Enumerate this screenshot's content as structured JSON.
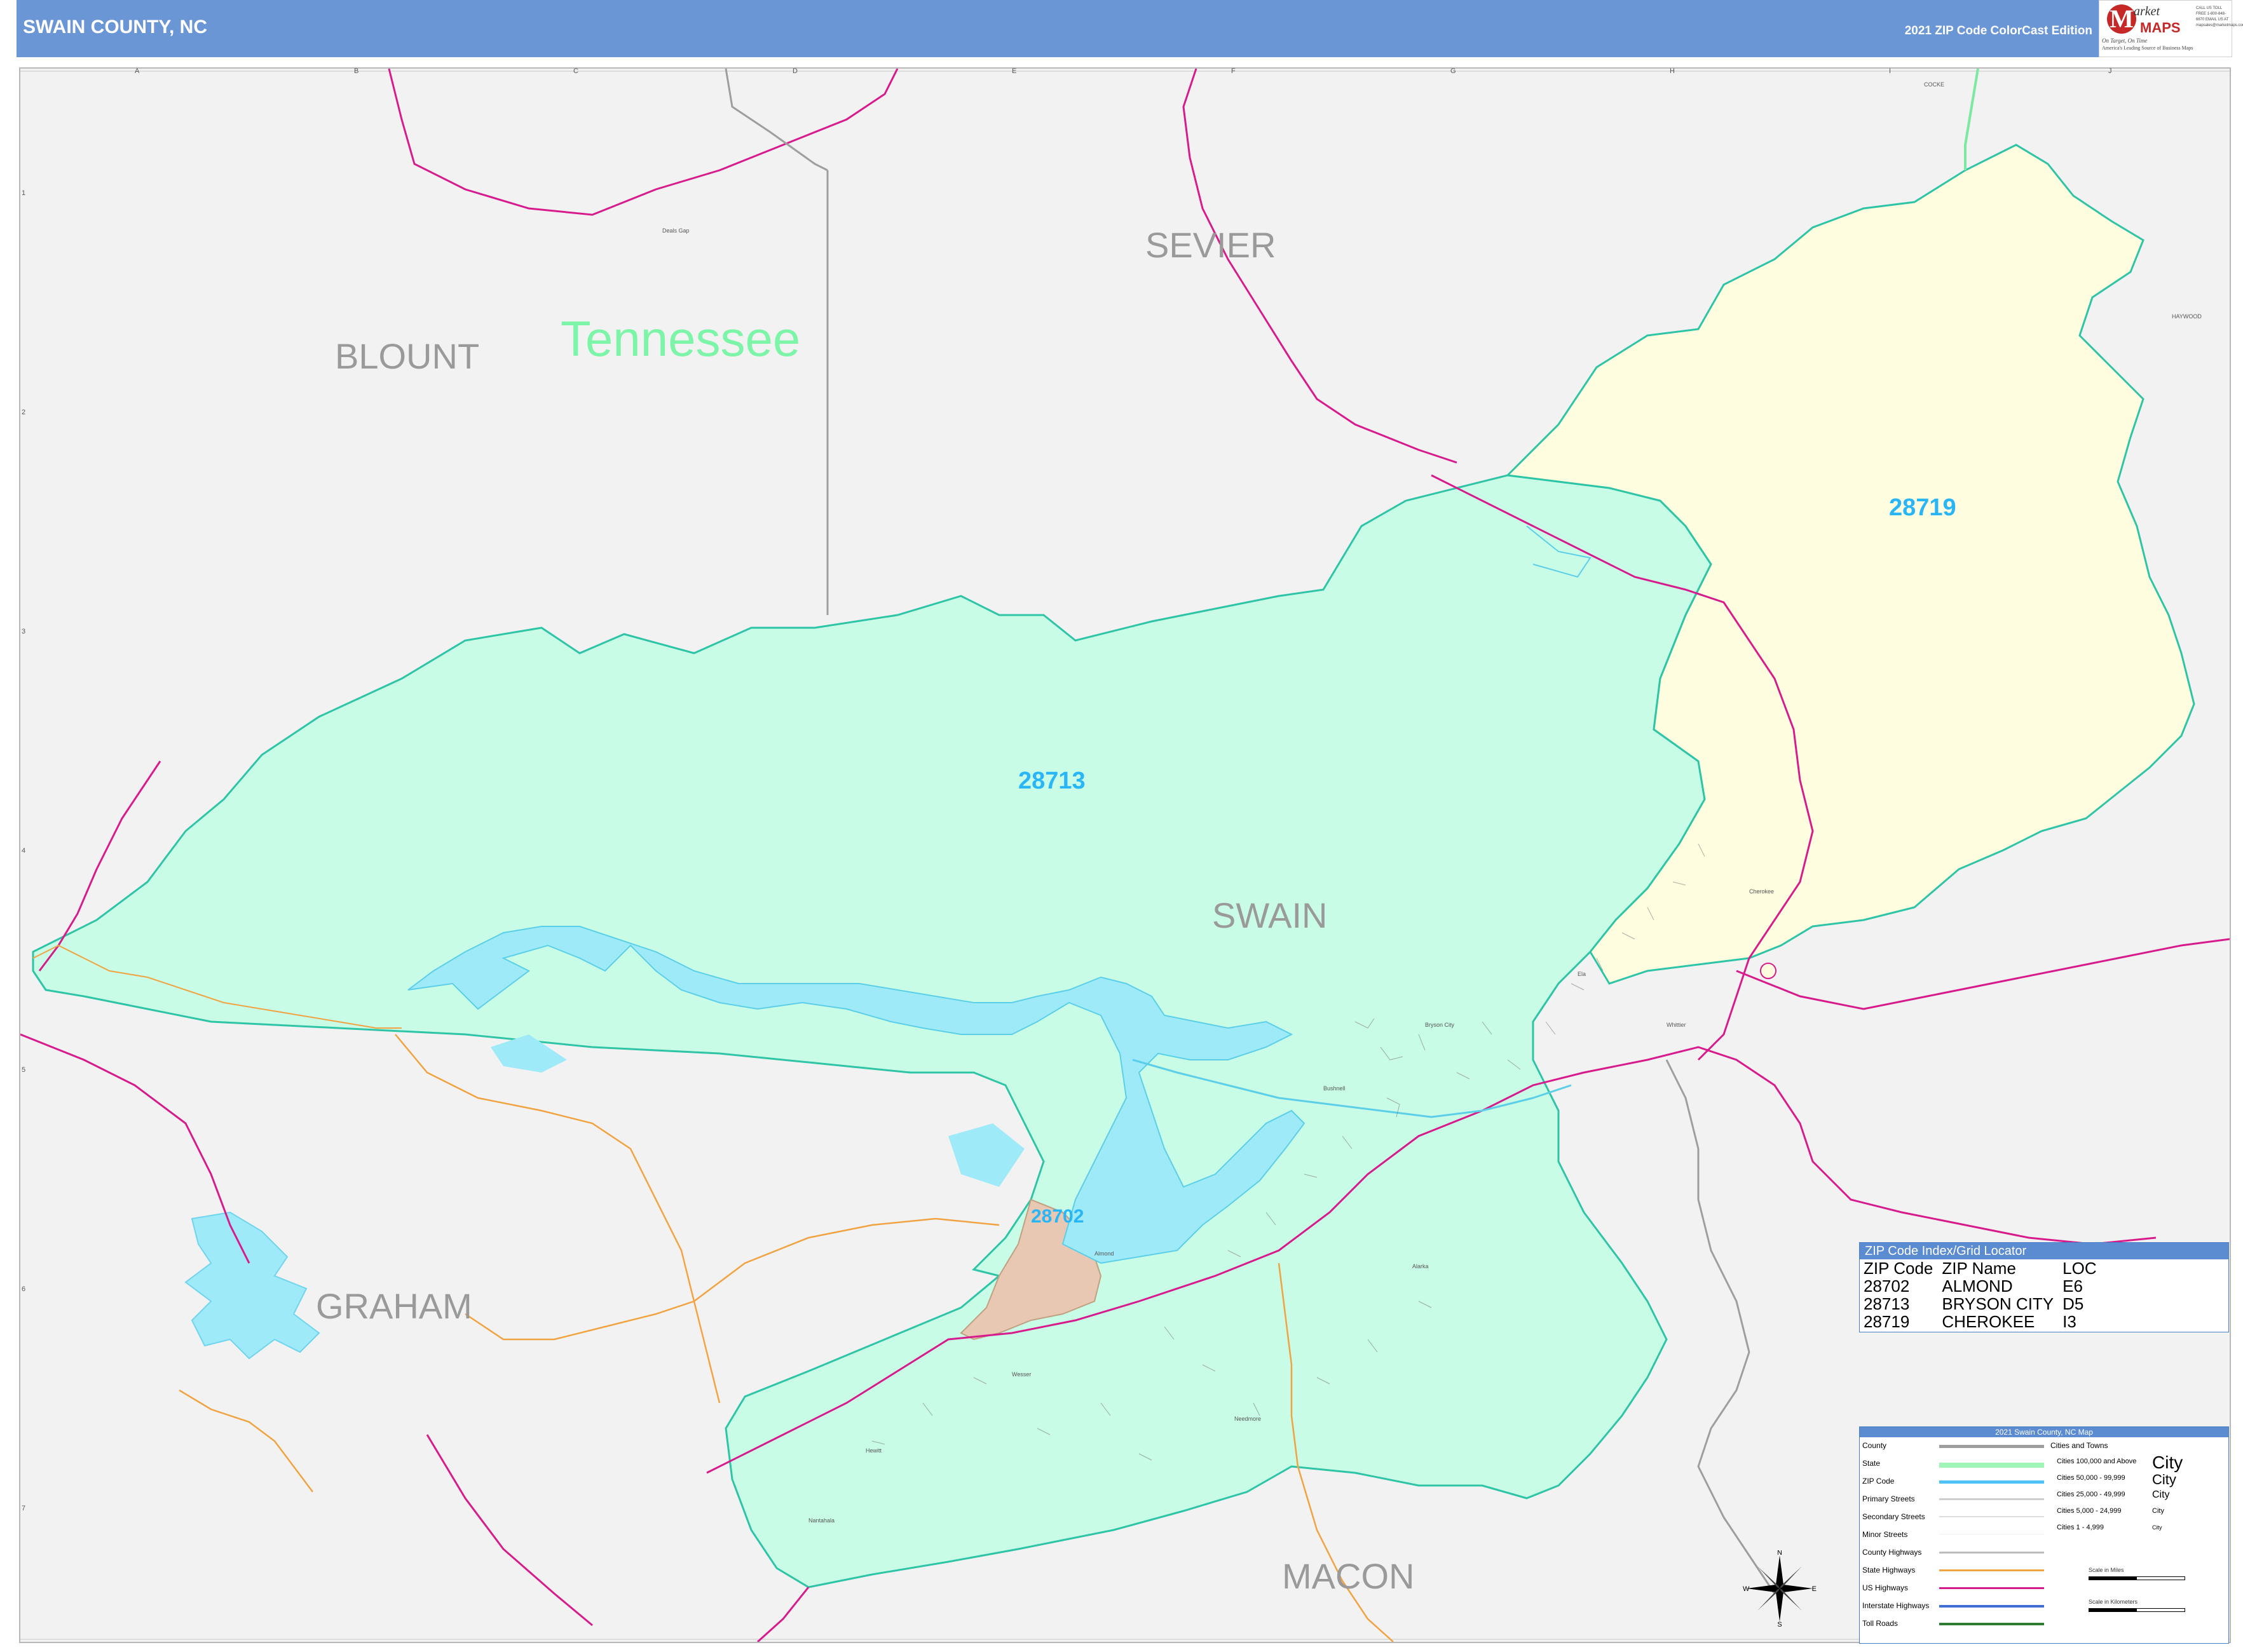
{
  "header": {
    "title": "SWAIN COUNTY, NC",
    "edition": "2021 ZIP Code ColorCast Edition",
    "logo": {
      "mark": "M",
      "word1": "arket",
      "word2": "MAPS",
      "tagline": "On Target, On Time",
      "leader": "America's Leading Source of Business Maps",
      "contact": "CALL US TOLL FREE 1-800-848-6670 EMAIL US AT mapsales@marketmaps.com"
    }
  },
  "grid": {
    "letters": [
      "A",
      "B",
      "C",
      "D",
      "E",
      "F",
      "G",
      "H",
      "I",
      "J"
    ],
    "numbers": [
      "1",
      "2",
      "3",
      "4",
      "5",
      "6",
      "7"
    ]
  },
  "labels": {
    "counties": [
      "BLOUNT",
      "SEVIER",
      "SWAIN",
      "GRAHAM",
      "MACON"
    ],
    "state": "Tennessee",
    "zips": [
      "28713",
      "28719",
      "28702"
    ],
    "corner_counties": [
      "COCKE",
      "HAYWOOD"
    ],
    "places": [
      "Almond",
      "Bryson City",
      "Cherokee",
      "Whittier",
      "Ela",
      "Wesser",
      "Nantahala",
      "Hewitt",
      "Needmore",
      "Alarka",
      "Bushnell",
      "Deals Gap"
    ]
  },
  "zip_index": {
    "title": "ZIP Code Index/Grid Locator",
    "columns": [
      "ZIP Code",
      "ZIP Name",
      "LOC"
    ],
    "rows": [
      [
        "28702",
        "ALMOND",
        "E6"
      ],
      [
        "28713",
        "BRYSON CITY",
        "D5"
      ],
      [
        "28719",
        "CHEROKEE",
        "I3"
      ]
    ]
  },
  "legend": {
    "title": "2021 Swain County, NC Map",
    "cities_title": "Cities and Towns",
    "items": [
      {
        "label": "County",
        "color": "#9e9e9e"
      },
      {
        "label": "State",
        "color": "#9ff5b8"
      },
      {
        "label": "ZIP Code",
        "color": "#4fc3f7"
      },
      {
        "label": "Primary Streets",
        "color": "#cfcfcf"
      },
      {
        "label": "Secondary Streets",
        "color": "#dddddd"
      },
      {
        "label": "Minor Streets",
        "color": "#eeeeee"
      },
      {
        "label": "County Highways",
        "color": "#bdbdbd"
      },
      {
        "label": "State Highways",
        "color": "#f0a340"
      },
      {
        "label": "US Highways",
        "color": "#d81b8c"
      },
      {
        "label": "Interstate Highways",
        "color": "#3f6fd1"
      },
      {
        "label": "Toll Roads",
        "color": "#2e7d32"
      }
    ],
    "cities": [
      {
        "range": "Cities 100,000 and Above",
        "name": "City"
      },
      {
        "range": "Cities 50,000 - 99,999",
        "name": "City"
      },
      {
        "range": "Cities 25,000 - 49,999",
        "name": "City"
      },
      {
        "range": "Cities 5,000 - 24,999",
        "name": "City"
      },
      {
        "range": "Cities 1 - 4,999",
        "name": "City"
      }
    ],
    "scale_miles": "Scale in Miles",
    "scale_km": "Scale in Kilometers"
  },
  "compass": {
    "n": "N",
    "s": "S",
    "e": "E",
    "w": "W"
  },
  "colors": {
    "zip_28713": "#c8fce6",
    "zip_28719": "#fffde0",
    "zip_28702": "#e8c7b3",
    "water": "#9eeaf9",
    "background": "#f2f2f2",
    "header": "#6b96d6"
  }
}
